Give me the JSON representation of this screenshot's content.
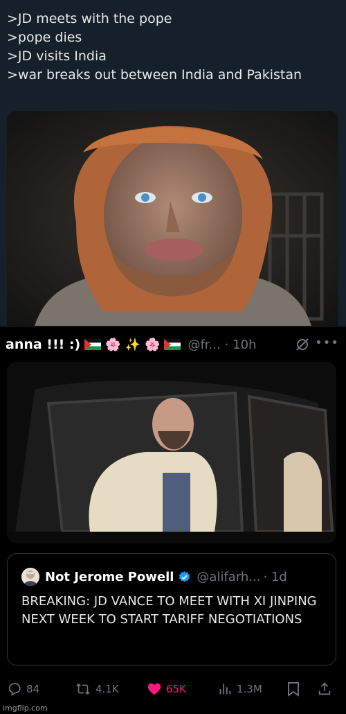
{
  "greentext": [
    ">JD meets with the pope",
    ">pope dies",
    ">JD visits India",
    ">war breaks out between India and Pakistan"
  ],
  "tweet": {
    "name": "anna !!! :)",
    "handle": "@fr...",
    "time": "· 10h",
    "emoji_sparkles": "✨",
    "emoji_flower": "🌸"
  },
  "quote": {
    "name": "Not Jerome Powell",
    "handle": "@alifarh...",
    "time": "· 1d",
    "text": "BREAKING: JD VANCE TO MEET WITH XI JINPING NEXT WEEK TO START TARIFF NEGOTIATIONS"
  },
  "actions": {
    "replies": "84",
    "reposts": "4.1K",
    "likes": "65K",
    "views": "1.3M"
  },
  "watermark": "imgflip.com",
  "colors": {
    "like": "#f91880",
    "muted": "#71767b",
    "verified": "#1d9bf0"
  }
}
